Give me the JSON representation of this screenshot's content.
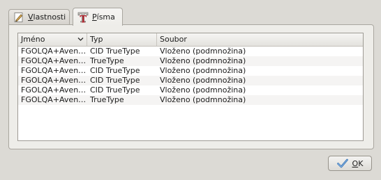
{
  "tabs": [
    {
      "label_prefix": "",
      "label_underlined": "V",
      "label_suffix": "lastnosti",
      "icon": "pencil-icon",
      "active": false
    },
    {
      "label_prefix": "",
      "label_underlined": "P",
      "label_suffix": "ísma",
      "icon": "font-icon",
      "active": true
    }
  ],
  "fonts_table": {
    "columns": [
      "Jméno",
      "Typ",
      "Soubor"
    ],
    "sorted_column": "Jméno",
    "rows": [
      {
        "name": "FGOLQA+Aven…",
        "type": "CID TrueType",
        "file": "Vloženo (podmnožina)"
      },
      {
        "name": "FGOLQA+Aven…",
        "type": "TrueType",
        "file": "Vloženo (podmnožina)"
      },
      {
        "name": "FGOLQA+Aven…",
        "type": "CID TrueType",
        "file": "Vloženo (podmnožina)"
      },
      {
        "name": "FGOLQA+Aven…",
        "type": "CID TrueType",
        "file": "Vloženo (podmnožina)"
      },
      {
        "name": "FGOLQA+Aven…",
        "type": "CID TrueType",
        "file": "Vloženo (podmnožina)"
      },
      {
        "name": "FGOLQA+Aven…",
        "type": "TrueType",
        "file": "Vloženo (podmnožina)"
      }
    ]
  },
  "ok_button": {
    "label_underlined": "O",
    "label_suffix": "K",
    "icon": "check-icon"
  },
  "colors": {
    "window_bg": "#dcdad5",
    "check_blue": "#2f6fb3"
  }
}
